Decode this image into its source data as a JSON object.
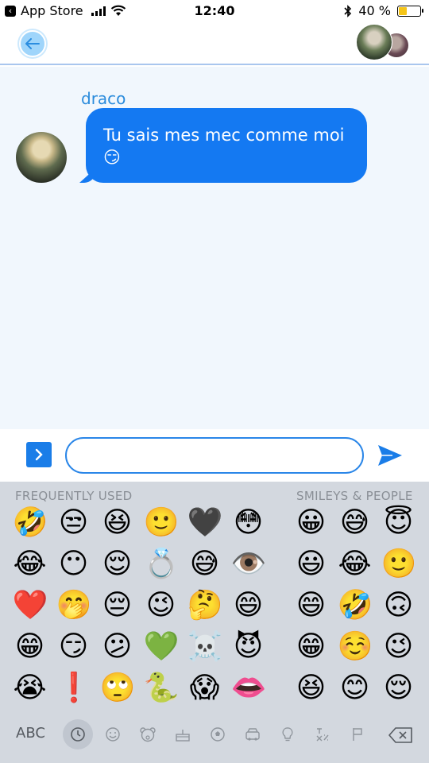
{
  "status_bar": {
    "back_app": "App Store",
    "time": "12:40",
    "battery_percent": "40 %",
    "battery_level": 0.4,
    "icons": [
      "back-chevron-icon",
      "signal-icon",
      "wifi-icon",
      "bluetooth-icon",
      "battery-icon"
    ]
  },
  "nav": {
    "back_icon": "arrow-left-icon",
    "avatars": [
      "contact-avatar",
      "contact-avatar-secondary"
    ]
  },
  "chat": {
    "messages": [
      {
        "sender": "draco",
        "text": "Tu sais mes mec comme moi",
        "emoji": "😏"
      }
    ]
  },
  "input": {
    "expand_icon": "chevron-right-icon",
    "value": "",
    "placeholder": "",
    "send_icon": "paper-plane-icon"
  },
  "keyboard": {
    "frequently_used_label": "FREQUENTLY USED",
    "smileys_label": "SMILEYS & PEOPLE",
    "frequently_used": [
      "🤣",
      "😒",
      "😆",
      "🙂",
      "🖤",
      "😳",
      "😂",
      "😶",
      "😌",
      "💍",
      "😅",
      "👁️",
      "❤️",
      "🤭",
      "😔",
      "😉",
      "🤔",
      "😄",
      "😁",
      "😏",
      "😕",
      "💚",
      "☠️",
      "😈",
      "😭",
      "❗",
      "🙄",
      "🐍",
      "😱",
      "👄"
    ],
    "smileys_people": [
      "😀",
      "😅",
      "😇",
      "",
      "😃",
      "😂",
      "🙂",
      "",
      "😄",
      "🤣",
      "🙃",
      "",
      "😁",
      "☺️",
      "😉",
      "",
      "😆",
      "😊",
      "😌",
      ""
    ],
    "abc_label": "ABC",
    "categories": [
      "clock-icon",
      "smiley-icon",
      "bear-icon",
      "cake-icon",
      "ball-icon",
      "car-icon",
      "bulb-icon",
      "symbols-icon",
      "flag-icon"
    ],
    "delete_icon": "delete-backspace-icon"
  }
}
